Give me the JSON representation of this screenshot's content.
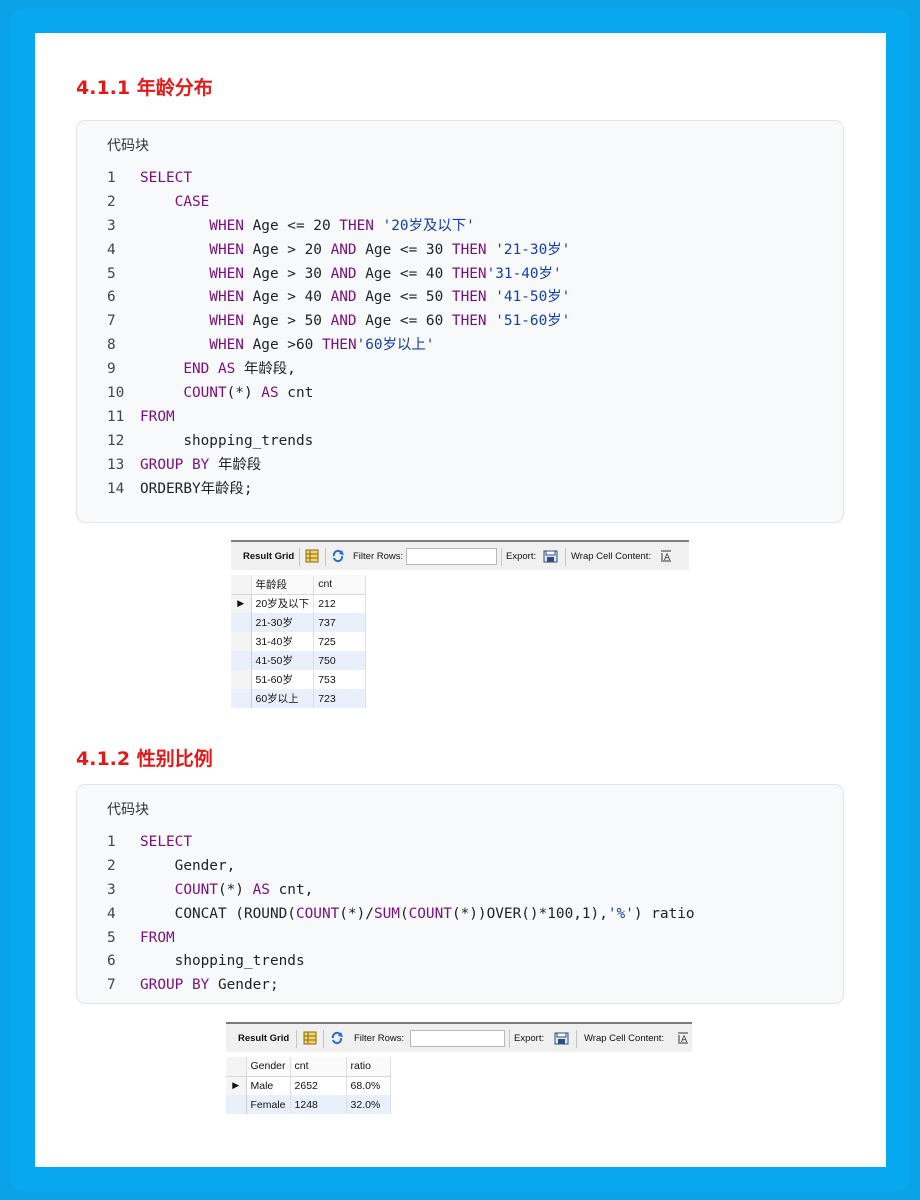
{
  "section1": {
    "heading": "4.1.1 年龄分布",
    "code_caption": "代码块",
    "code_lines": [
      {
        "n": "1",
        "segs": [
          {
            "t": "SELECT",
            "c": "kw"
          }
        ]
      },
      {
        "n": "2",
        "segs": [
          {
            "t": "    CASE",
            "c": "kw"
          }
        ]
      },
      {
        "n": "3",
        "segs": [
          {
            "t": "        WHEN",
            "c": "kw"
          },
          {
            "t": " Age <= 20 ",
            "c": ""
          },
          {
            "t": "THEN",
            "c": "kw"
          },
          {
            "t": " ",
            "c": ""
          },
          {
            "t": "'20岁及以下'",
            "c": "st"
          }
        ]
      },
      {
        "n": "4",
        "segs": [
          {
            "t": "        WHEN",
            "c": "kw"
          },
          {
            "t": " Age > 20 ",
            "c": ""
          },
          {
            "t": "AND",
            "c": "kw"
          },
          {
            "t": " Age <= 30 ",
            "c": ""
          },
          {
            "t": "THEN",
            "c": "kw"
          },
          {
            "t": " ",
            "c": ""
          },
          {
            "t": "'21-30岁'",
            "c": "st"
          }
        ]
      },
      {
        "n": "5",
        "segs": [
          {
            "t": "        WHEN",
            "c": "kw"
          },
          {
            "t": " Age > 30 ",
            "c": ""
          },
          {
            "t": "AND",
            "c": "kw"
          },
          {
            "t": " Age <= 40 ",
            "c": ""
          },
          {
            "t": "THEN",
            "c": "kw"
          },
          {
            "t": "'31-40岁'",
            "c": "st"
          }
        ]
      },
      {
        "n": "6",
        "segs": [
          {
            "t": "        WHEN",
            "c": "kw"
          },
          {
            "t": " Age > 40 ",
            "c": ""
          },
          {
            "t": "AND",
            "c": "kw"
          },
          {
            "t": " Age <= 50 ",
            "c": ""
          },
          {
            "t": "THEN",
            "c": "kw"
          },
          {
            "t": " ",
            "c": ""
          },
          {
            "t": "'41-50岁'",
            "c": "st"
          }
        ]
      },
      {
        "n": "7",
        "segs": [
          {
            "t": "        WHEN",
            "c": "kw"
          },
          {
            "t": " Age > 50 ",
            "c": ""
          },
          {
            "t": "AND",
            "c": "kw"
          },
          {
            "t": " Age <= 60 ",
            "c": ""
          },
          {
            "t": "THEN",
            "c": "kw"
          },
          {
            "t": " ",
            "c": ""
          },
          {
            "t": "'51-60岁'",
            "c": "st"
          }
        ]
      },
      {
        "n": "8",
        "segs": [
          {
            "t": "        WHEN",
            "c": "kw"
          },
          {
            "t": " Age >60 ",
            "c": ""
          },
          {
            "t": "THEN",
            "c": "kw"
          },
          {
            "t": "'60岁以上'",
            "c": "st"
          }
        ]
      },
      {
        "n": "9",
        "segs": [
          {
            "t": "     END AS",
            "c": "kw"
          },
          {
            "t": " 年龄段,",
            "c": ""
          }
        ]
      },
      {
        "n": "10",
        "segs": [
          {
            "t": "     COUNT",
            "c": "fn"
          },
          {
            "t": "(*) ",
            "c": ""
          },
          {
            "t": "AS",
            "c": "kw"
          },
          {
            "t": " cnt",
            "c": ""
          }
        ]
      },
      {
        "n": "11",
        "segs": [
          {
            "t": "FROM",
            "c": "kw"
          }
        ]
      },
      {
        "n": "12",
        "segs": [
          {
            "t": "     shopping_trends",
            "c": ""
          }
        ]
      },
      {
        "n": "13",
        "segs": [
          {
            "t": "GROUP BY",
            "c": "kw"
          },
          {
            "t": " 年龄段",
            "c": ""
          }
        ]
      },
      {
        "n": "14",
        "segs": [
          {
            "t": "ORDERBY年龄段;",
            "c": ""
          }
        ]
      }
    ],
    "result": {
      "toolbar": {
        "result_grid": "Result Grid",
        "filter_rows": "Filter Rows:",
        "export": "Export:",
        "wrap": "Wrap Cell Content:"
      },
      "columns": [
        "年龄段",
        "cnt"
      ],
      "rows": [
        [
          "20岁及以下",
          "212"
        ],
        [
          "21-30岁",
          "737"
        ],
        [
          "31-40岁",
          "725"
        ],
        [
          "41-50岁",
          "750"
        ],
        [
          "51-60岁",
          "753"
        ],
        [
          "60岁以上",
          "723"
        ]
      ]
    }
  },
  "section2": {
    "heading": "4.1.2 性别比例",
    "code_caption": "代码块",
    "code_lines": [
      {
        "n": "1",
        "segs": [
          {
            "t": "SELECT",
            "c": "kw"
          }
        ]
      },
      {
        "n": "2",
        "segs": [
          {
            "t": "    Gender,",
            "c": ""
          }
        ]
      },
      {
        "n": "3",
        "segs": [
          {
            "t": "    COUNT",
            "c": "fn"
          },
          {
            "t": "(*) ",
            "c": ""
          },
          {
            "t": "AS",
            "c": "kw"
          },
          {
            "t": " cnt,",
            "c": ""
          }
        ]
      },
      {
        "n": "4",
        "segs": [
          {
            "t": "    CONCAT (ROUND(",
            "c": ""
          },
          {
            "t": "COUNT",
            "c": "fn"
          },
          {
            "t": "(*)/",
            "c": ""
          },
          {
            "t": "SUM",
            "c": "fn"
          },
          {
            "t": "(",
            "c": ""
          },
          {
            "t": "COUNT",
            "c": "fn"
          },
          {
            "t": "(*))OVER()*100,1),",
            "c": ""
          },
          {
            "t": "'%'",
            "c": "st"
          },
          {
            "t": ") ratio",
            "c": ""
          }
        ]
      },
      {
        "n": "5",
        "segs": [
          {
            "t": "FROM",
            "c": "kw"
          }
        ]
      },
      {
        "n": "6",
        "segs": [
          {
            "t": "    shopping_trends",
            "c": ""
          }
        ]
      },
      {
        "n": "7",
        "segs": [
          {
            "t": "GROUP BY",
            "c": "kw"
          },
          {
            "t": " Gender;",
            "c": ""
          }
        ]
      }
    ],
    "result": {
      "toolbar": {
        "result_grid": "Result Grid",
        "filter_rows": "Filter Rows:",
        "export": "Export:",
        "wrap": "Wrap Cell Content:"
      },
      "columns": [
        "Gender",
        "cnt",
        "ratio"
      ],
      "rows": [
        [
          "Male",
          "2652",
          "68.0%"
        ],
        [
          "Female",
          "1248",
          "32.0%"
        ]
      ]
    }
  }
}
